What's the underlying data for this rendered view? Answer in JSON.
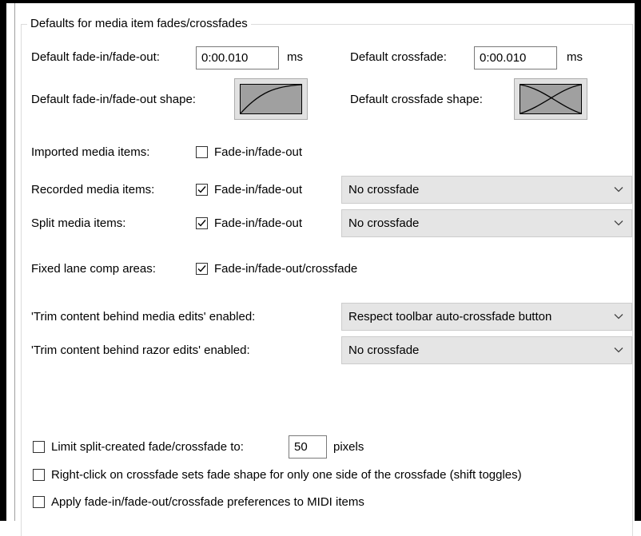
{
  "group": {
    "title": "Defaults for media item fades/crossfades"
  },
  "fade": {
    "default_fade_label": "Default fade-in/fade-out:",
    "default_fade_value": "0:00.010",
    "default_fade_unit": "ms",
    "default_crossfade_label": "Default crossfade:",
    "default_crossfade_value": "0:00.010",
    "default_crossfade_unit": "ms",
    "fade_shape_label": "Default fade-in/fade-out shape:",
    "crossfade_shape_label": "Default crossfade shape:"
  },
  "items": {
    "imported": {
      "label": "Imported media items:",
      "checkbox_label": "Fade-in/fade-out",
      "checked": false
    },
    "recorded": {
      "label": "Recorded media items:",
      "checkbox_label": "Fade-in/fade-out",
      "checked": true,
      "dropdown": "No crossfade"
    },
    "split": {
      "label": "Split media items:",
      "checkbox_label": "Fade-in/fade-out",
      "checked": true,
      "dropdown": "No crossfade"
    },
    "fixed_lane": {
      "label": "Fixed lane comp areas:",
      "checkbox_label": "Fade-in/fade-out/crossfade",
      "checked": true
    }
  },
  "trim": {
    "media_label": "'Trim content behind media edits' enabled:",
    "media_dropdown": "Respect toolbar auto-crossfade button",
    "razor_label": "'Trim content behind razor edits' enabled:",
    "razor_dropdown": "No crossfade"
  },
  "bottom": {
    "limit_label": "Limit split-created fade/crossfade to:",
    "limit_value": "50",
    "limit_unit": "pixels",
    "limit_checked": false,
    "right_click_label": "Right-click on crossfade sets fade shape for only one side of the crossfade (shift toggles)",
    "right_click_checked": false,
    "apply_midi_label": "Apply fade-in/fade-out/crossfade preferences to MIDI items",
    "apply_midi_checked": false
  },
  "icons": {
    "checkmark": "checkmark-icon",
    "chevron": "chevron-down-icon",
    "fade_curve": "fade-curve-icon",
    "crossfade_curve": "crossfade-curve-icon"
  }
}
